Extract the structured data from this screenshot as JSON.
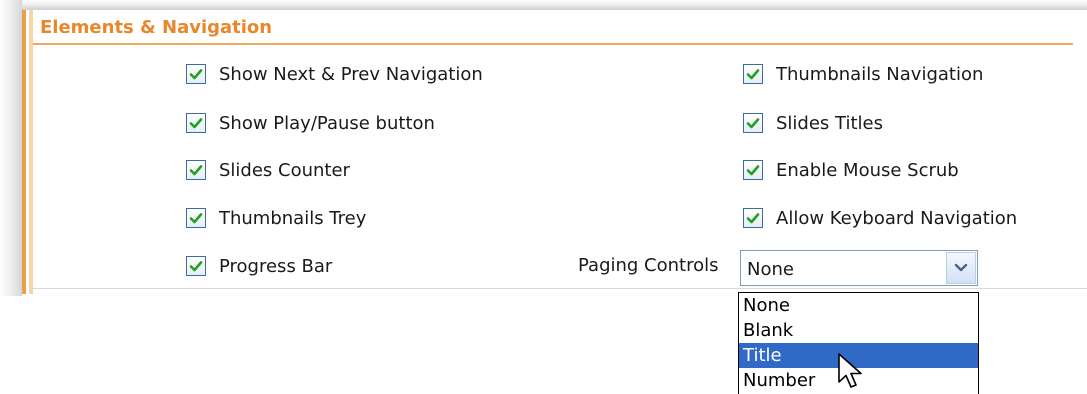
{
  "section": {
    "title": "Elements & Navigation"
  },
  "left_options": [
    {
      "label": "Show Next & Prev Navigation",
      "checked": true
    },
    {
      "label": "Show Play/Pause button",
      "checked": true
    },
    {
      "label": "Slides Counter",
      "checked": true
    },
    {
      "label": "Thumbnails Trey",
      "checked": true
    },
    {
      "label": "Progress Bar",
      "checked": true
    }
  ],
  "right_options": [
    {
      "label": "Thumbnails Navigation",
      "checked": true
    },
    {
      "label": "Slides Titles",
      "checked": true
    },
    {
      "label": "Enable Mouse Scrub",
      "checked": true
    },
    {
      "label": "Allow Keyboard Navigation",
      "checked": true
    }
  ],
  "paging": {
    "label": "Paging Controls",
    "selected": "None",
    "options": [
      "None",
      "Blank",
      "Title",
      "Number"
    ],
    "highlighted": "Title"
  },
  "colors": {
    "accent": "#e8872c",
    "checkbox_border": "#3a6e9e",
    "checkmark": "#21a121",
    "highlight": "#3169c6"
  }
}
